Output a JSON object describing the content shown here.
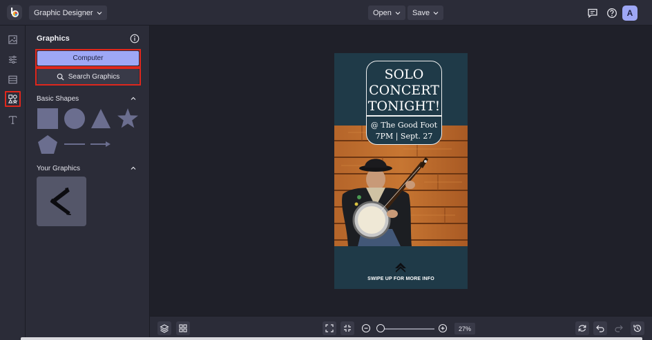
{
  "topbar": {
    "mode_label": "Graphic Designer",
    "open_label": "Open",
    "save_label": "Save",
    "avatar_initial": "A"
  },
  "rail": {
    "items": [
      {
        "icon": "image-icon"
      },
      {
        "icon": "sliders-icon"
      },
      {
        "icon": "layout-icon"
      },
      {
        "icon": "graphics-icon",
        "active": true
      },
      {
        "icon": "text-icon"
      }
    ]
  },
  "panel": {
    "title": "Graphics",
    "computer_label": "Computer",
    "search_label": "Search Graphics",
    "basic_shapes_title": "Basic Shapes",
    "your_graphics_title": "Your Graphics",
    "shape_color": "#6b6e8f"
  },
  "poster": {
    "title_lines": "SOLO CONCERT TONIGHT!",
    "venue": "@ The Good Foot",
    "time": "7PM | Sept. 27",
    "swipe": "SWIPE UP FOR MORE INFO",
    "bg_color": "#1f3a48"
  },
  "bottombar": {
    "zoom_value": "27%"
  },
  "colors": {
    "accent": "#9ea7f5",
    "highlight": "#e0271c"
  }
}
